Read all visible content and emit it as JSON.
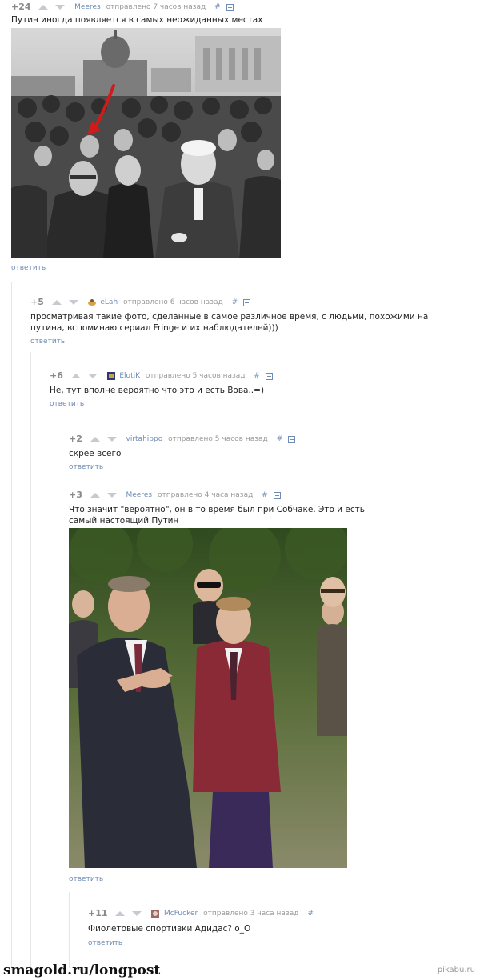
{
  "comments": [
    {
      "rating": "+24",
      "user": "Meeres",
      "posted": "отправлено 7 часов назад",
      "hash": "#",
      "text": "Путин иногда появляется в самых неожиданных местах",
      "reply": "ответить",
      "image": "black-and-white crowd photo with red arrow"
    },
    {
      "rating": "+5",
      "user": "eLah",
      "posted": "отправлено 6 часов назад",
      "hash": "#",
      "text": "просматривая такие фото, сделанные в самое различное время, с людьми, похожими на путина, вспоминаю сериал Fringe и их наблюдателей)))",
      "reply": "ответить"
    },
    {
      "rating": "+6",
      "user": "ElotiK",
      "posted": "отправлено 5 часов назад",
      "hash": "#",
      "text": "Не, тут вполне вероятно что это и есть Вова..=)",
      "reply": "ответить"
    },
    {
      "rating": "+2",
      "user": "virtahippo",
      "posted": "отправлено 5 часов назад",
      "hash": "#",
      "text": "скрее всего",
      "reply": "ответить"
    },
    {
      "rating": "+3",
      "user": "Meeres",
      "posted": "отправлено 4 часа назад",
      "hash": "#",
      "text": "Что значит \"вероятно\", он в то время был при Собчаке. Это и есть самый настоящий Путин",
      "reply": "ответить",
      "image": "color photo of men in suits walking outdoors"
    },
    {
      "rating": "+11",
      "user": "McFucker",
      "posted": "отправлено 3 часа назад",
      "hash": "#",
      "text": "Фиолетовые спортивки Адидас? о_О",
      "reply": "ответить"
    }
  ],
  "footer": {
    "source": "smagold.ru/longpost",
    "watermark": "pikabu.ru"
  },
  "colors": {
    "link": "#6e8cb5",
    "arrow": "#d11a1a",
    "thread_line": "#e6e6e6"
  }
}
